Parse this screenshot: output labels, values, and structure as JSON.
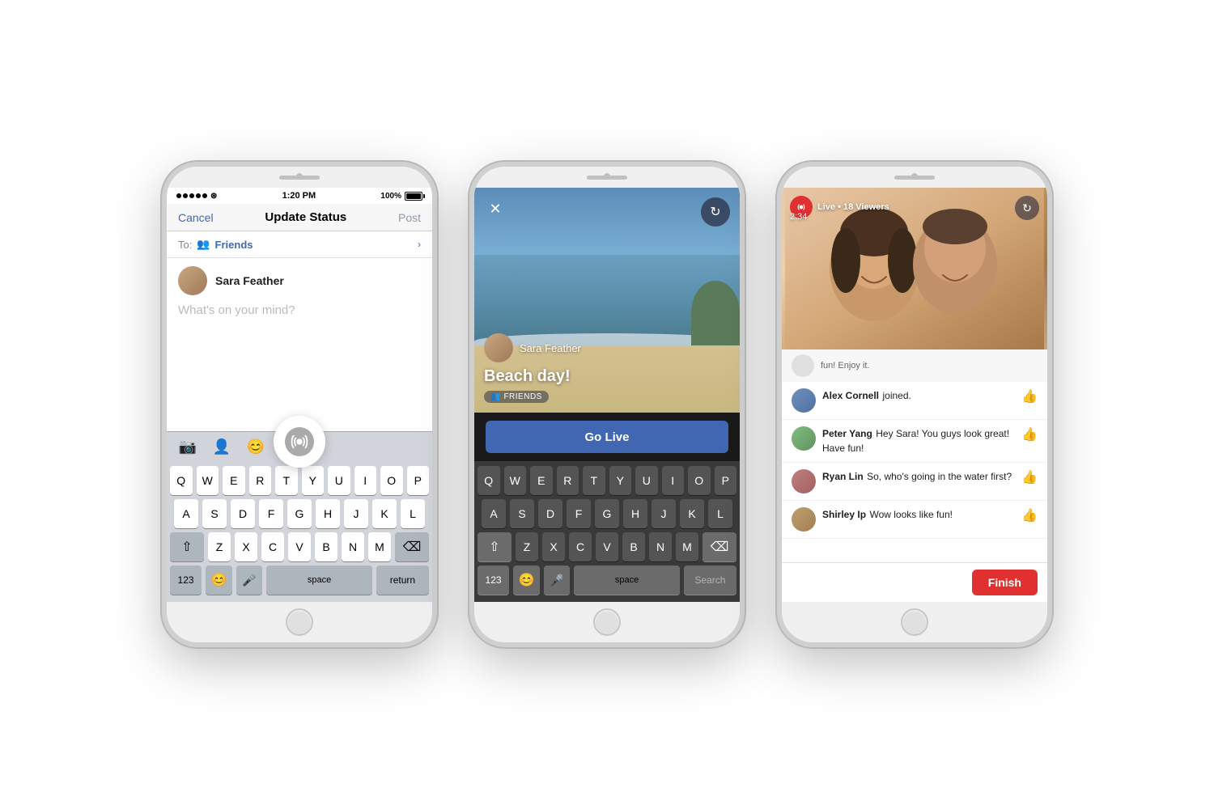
{
  "phones": [
    {
      "id": "phone1",
      "statusBar": {
        "signal": "●●●●●",
        "wifi": "WiFi",
        "time": "1:20 PM",
        "battery": "100%"
      },
      "nav": {
        "cancel": "Cancel",
        "title": "Update Status",
        "post": "Post"
      },
      "audience": {
        "to": "To:",
        "friends": "Friends"
      },
      "user": {
        "name": "Sara Feather"
      },
      "placeholder": "What's on your mind?",
      "toolbar": {
        "icons": [
          "📷",
          "👤",
          "😊"
        ]
      },
      "keyboard": {
        "rows": [
          [
            "Q",
            "W",
            "E",
            "R",
            "T",
            "Y",
            "U",
            "I",
            "O",
            "P"
          ],
          [
            "A",
            "S",
            "D",
            "F",
            "G",
            "H",
            "J",
            "K",
            "L"
          ],
          [
            "⇧",
            "Z",
            "X",
            "C",
            "V",
            "B",
            "N",
            "M",
            "⌫"
          ],
          [
            "123",
            "😊",
            "🎤",
            "space",
            "return"
          ]
        ]
      }
    },
    {
      "id": "phone2",
      "statusBar": {
        "time": ""
      },
      "controls": {
        "close": "✕",
        "flip": "↻"
      },
      "overlay": {
        "userName": "Sara Feather",
        "title": "Beach day!",
        "audience": "FRIENDS"
      },
      "goLive": {
        "label": "Go Live"
      },
      "keyboard": {
        "rows": [
          [
            "Q",
            "W",
            "E",
            "R",
            "T",
            "Y",
            "U",
            "I",
            "O",
            "P"
          ],
          [
            "A",
            "S",
            "D",
            "F",
            "G",
            "H",
            "J",
            "K",
            "L"
          ],
          [
            "⇧",
            "Z",
            "X",
            "C",
            "V",
            "B",
            "N",
            "M",
            "⌫"
          ],
          [
            "123",
            "😊",
            "🎤",
            "space",
            "Search"
          ]
        ]
      }
    },
    {
      "id": "phone3",
      "statusBar": {
        "time": ""
      },
      "liveInfo": {
        "live": "Live",
        "dot": "●",
        "viewers": "18 Viewers",
        "timer": "2:34"
      },
      "comments": [
        {
          "system": true,
          "text": "fun! Enjoy it."
        },
        {
          "name": "Alex Cornell",
          "text": "joined.",
          "liked": false,
          "avatarClass": "avatar-p2"
        },
        {
          "name": "Peter Yang",
          "text": "Hey Sara! You guys look great! Have fun!",
          "liked": true,
          "avatarClass": "avatar-p3"
        },
        {
          "name": "Ryan Lin",
          "text": "So, who's going in the water first?",
          "liked": false,
          "avatarClass": "avatar-p4"
        },
        {
          "name": "Shirley Ip",
          "text": "Wow looks like fun!",
          "liked": false,
          "avatarClass": "avatar-p5"
        }
      ],
      "finishButton": "Finish"
    }
  ]
}
